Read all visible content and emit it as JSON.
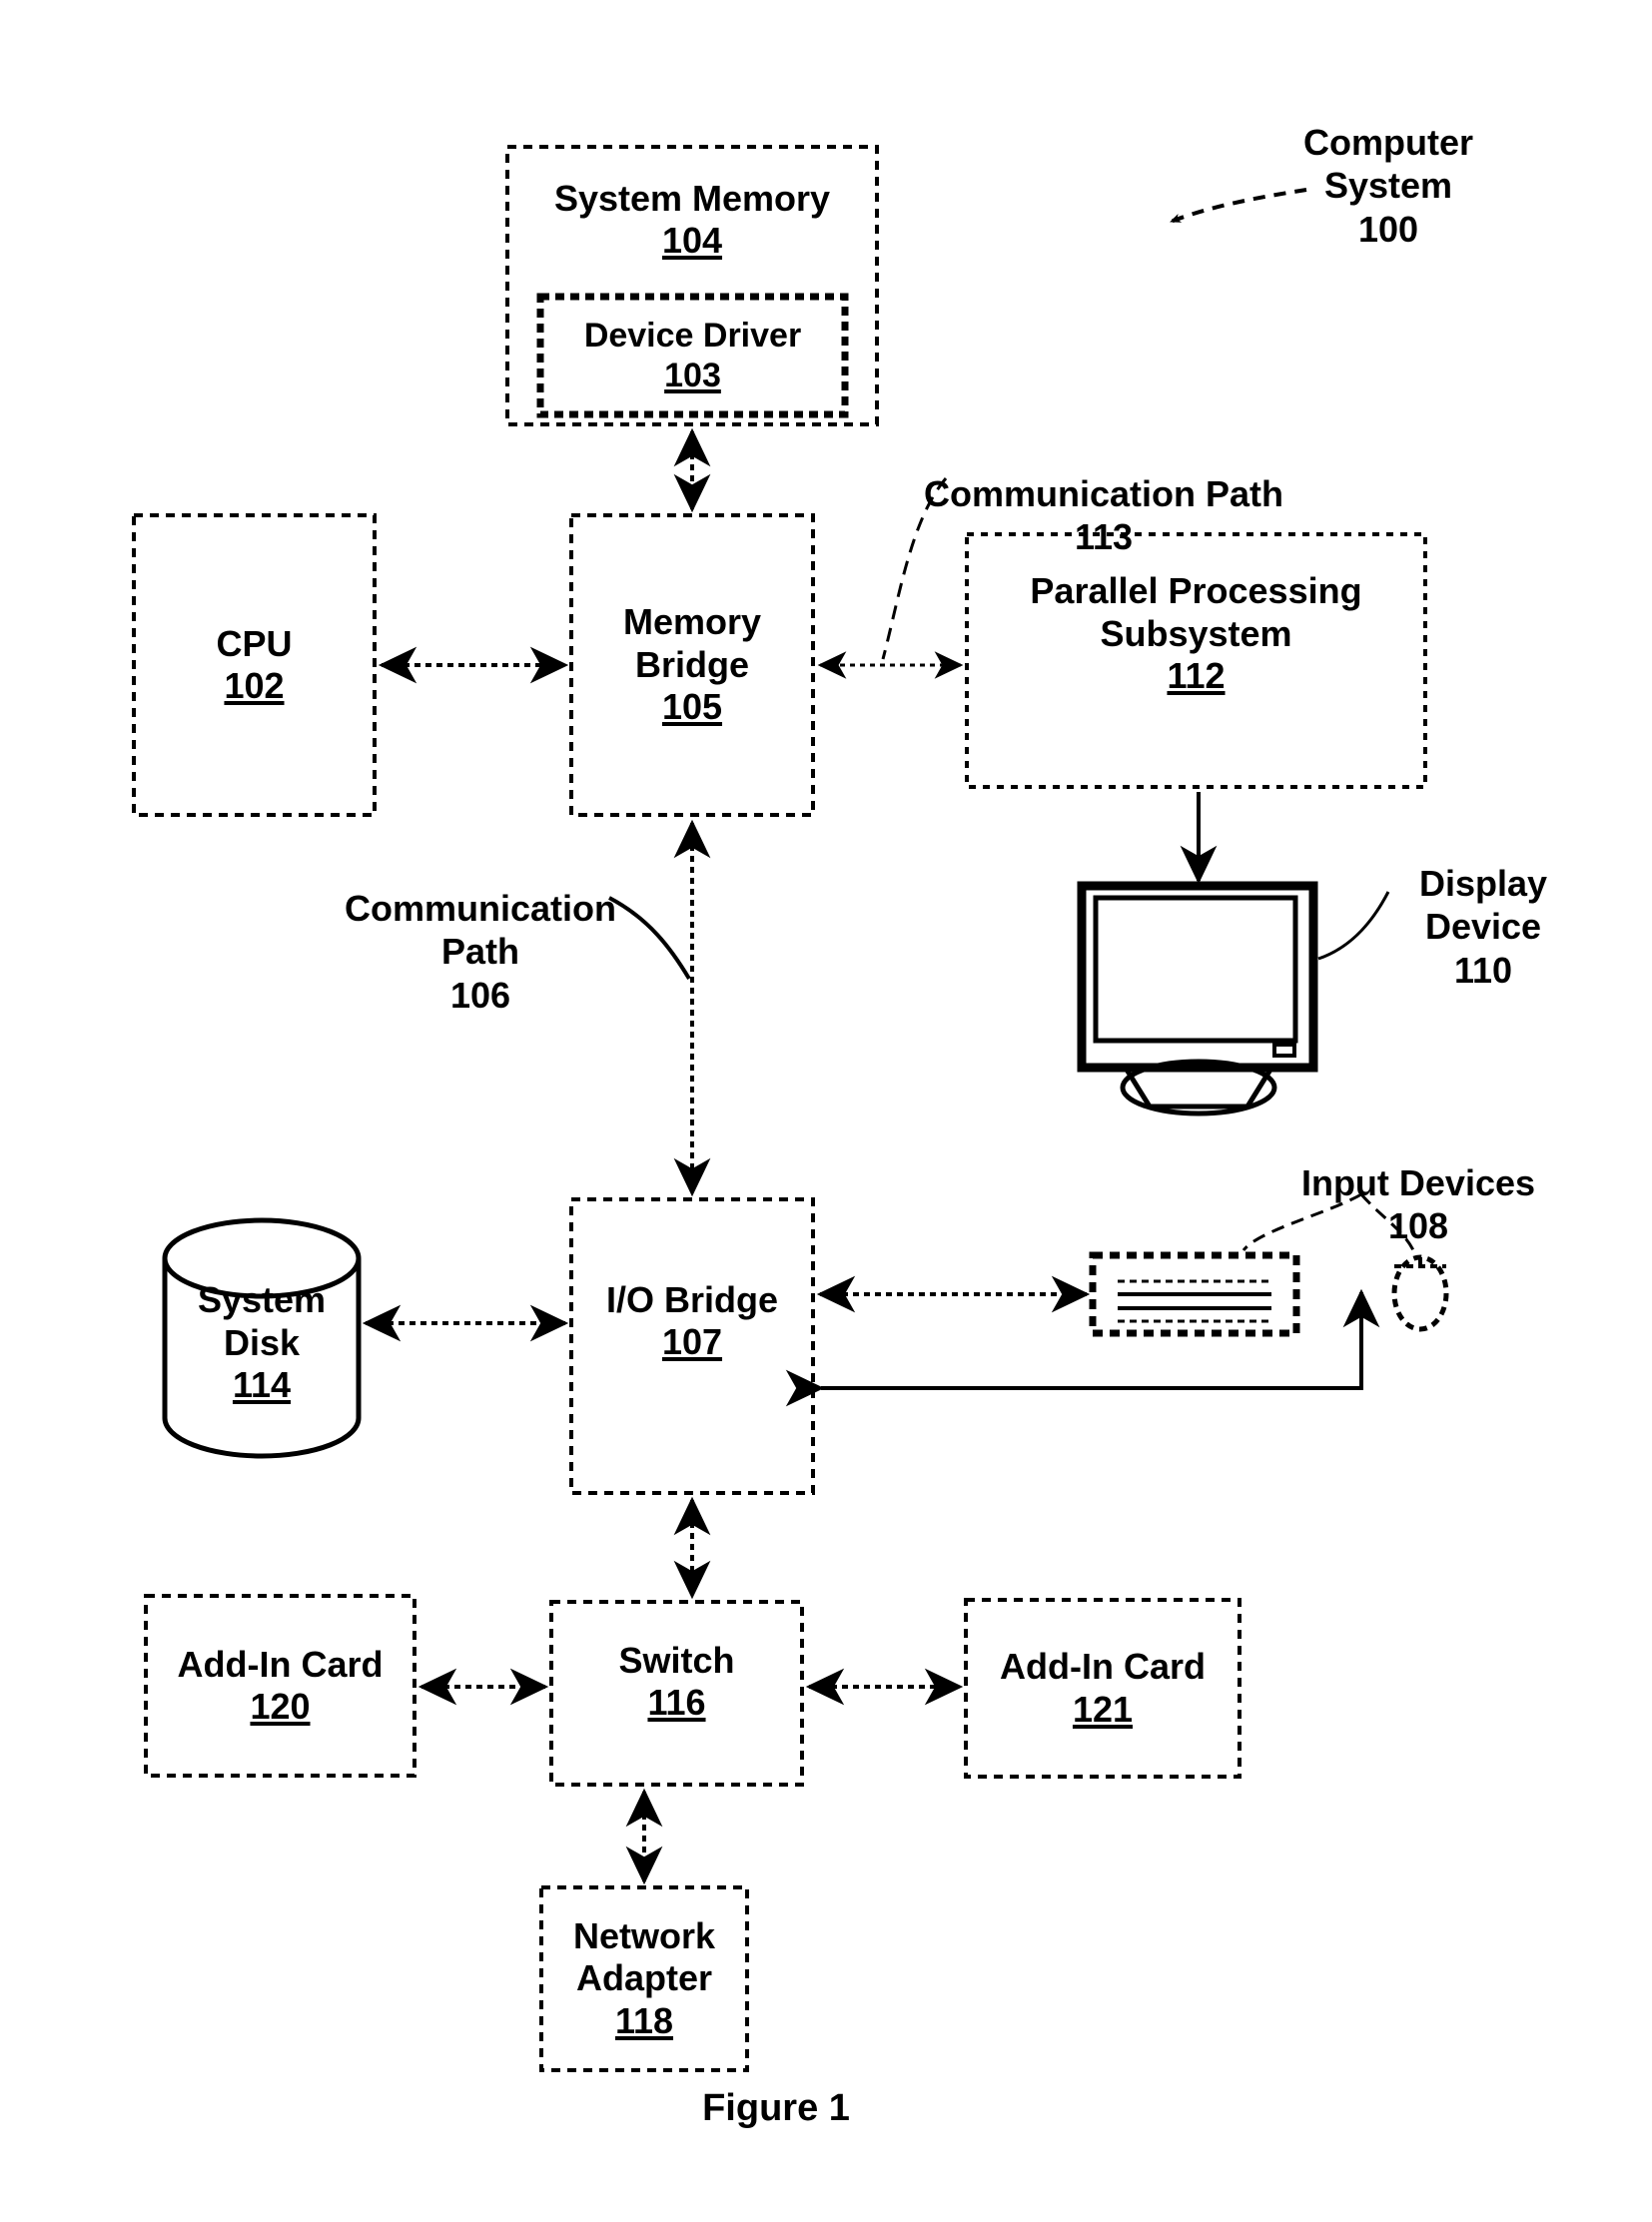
{
  "figure": {
    "caption": "Figure 1",
    "title_callout": {
      "label": "Computer\nSystem",
      "number": "100"
    }
  },
  "blocks": {
    "system_memory": {
      "label": "System Memory",
      "number": "104"
    },
    "device_driver": {
      "label": "Device Driver",
      "number": "103"
    },
    "cpu": {
      "label": "CPU",
      "number": "102"
    },
    "memory_bridge": {
      "label": "Memory\nBridge",
      "number": "105"
    },
    "parallel_processing_subsystem": {
      "label": "Parallel Processing\nSubsystem",
      "number": "112"
    },
    "io_bridge": {
      "label": "I/O Bridge",
      "number": "107"
    },
    "system_disk": {
      "label": "System\nDisk",
      "number": "114"
    },
    "switch": {
      "label": "Switch",
      "number": "116"
    },
    "add_in_card_120": {
      "label": "Add-In Card",
      "number": "120"
    },
    "add_in_card_121": {
      "label": "Add-In Card",
      "number": "121"
    },
    "network_adapter": {
      "label": "Network\nAdapter",
      "number": "118"
    }
  },
  "callouts": {
    "communication_path_113": {
      "label": "Communication Path",
      "number": "113"
    },
    "communication_path_106": {
      "label": "Communication\nPath",
      "number": "106"
    },
    "display_device": {
      "label": "Display\nDevice",
      "number": "110"
    },
    "input_devices": {
      "label": "Input Devices",
      "number": "108"
    }
  },
  "icons": {
    "display_device_icon": "monitor-icon",
    "keyboard_icon": "keyboard-icon",
    "mouse_icon": "mouse-icon",
    "system_disk_icon": "cylinder-database-icon"
  },
  "colors": {
    "stroke": "#000000",
    "background": "#ffffff"
  }
}
